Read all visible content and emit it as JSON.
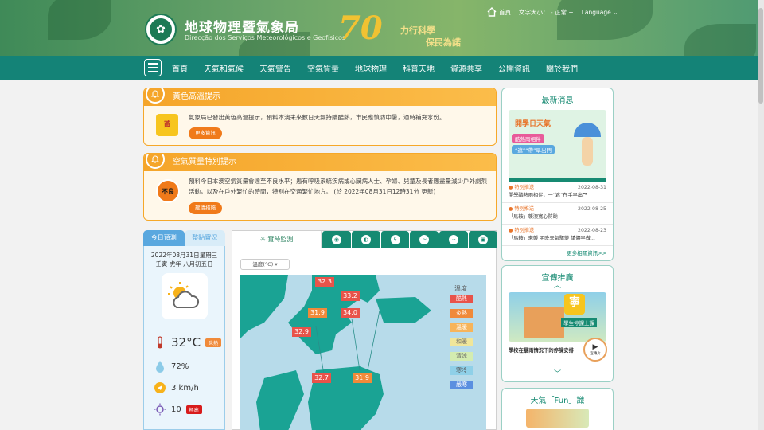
{
  "header": {
    "title": "地球物理暨氣象局",
    "subtitle": "Direcção dos Serviços Meteorológicos e Geofísicos",
    "anniversary": "70",
    "slogan_line1": "力行科學",
    "slogan_line2": "保民為諾",
    "home": "首頁",
    "font_size": "文字大小：",
    "font_minus": "-",
    "font_normal": "正常",
    "font_plus": "+",
    "language": "Language"
  },
  "nav": {
    "items": [
      "首頁",
      "天氣和氣候",
      "天氣警告",
      "空氣質量",
      "地球物理",
      "科普天地",
      "資源共享",
      "公開資訊",
      "關於我們"
    ]
  },
  "alerts": [
    {
      "title": "黃色高溫提示",
      "icon_text": "黃",
      "text": "氣象局已發出黃色高溫提示，預料本澳未來數日天氣持續酷熱，市民應慎防中暑，適時補充水份。",
      "button": "更多資訊"
    },
    {
      "title": "空氣質量特別提示",
      "icon_text": "不良",
      "text": "預料今日本澳空氣質量會達至不良水平；患有呼吸系統疾病或心臟病人士、孕婦、兒童及長者應盡量減少戶外劇烈活動，以及在戶外繁忙的時間，特別在交通繁忙地方。 (於 2022年08月31日12時31分 更新)",
      "button": "建議措施"
    }
  ],
  "forecast": {
    "tab_today": "今日預測",
    "tab_hourly": "整點實況",
    "date_line1": "2022年08月31日星期三",
    "date_line2": "壬寅 虎年 八月初五日",
    "temperature": "32°C",
    "temp_tag": "炎熱",
    "humidity": "72%",
    "wind": "3 km/h",
    "uv": "10",
    "uv_tag": "極高"
  },
  "monitor": {
    "tab_label": "實時監測",
    "select_label": "溫度(°C)",
    "legend_title": "溫度",
    "legend": [
      {
        "label": "酷熱",
        "color": "#e8534a"
      },
      {
        "label": "炎熱",
        "color": "#f08a3a"
      },
      {
        "label": "溫暖",
        "color": "#f7b45a"
      },
      {
        "label": "和暖",
        "color": "#f0e69a"
      },
      {
        "label": "清涼",
        "color": "#d3ecb0"
      },
      {
        "label": "寒冷",
        "color": "#8fd0e8"
      },
      {
        "label": "嚴寒",
        "color": "#5a8fe0"
      }
    ],
    "readings": [
      "32.3",
      "33.2",
      "31.9",
      "34.0",
      "32.9",
      "32.7",
      "31.9"
    ]
  },
  "news": {
    "title": "最新消息",
    "img_line1": "開學日天氣",
    "img_line2": "酷熱雨相伴",
    "img_line3": "“遮”“帶”早出門",
    "items": [
      {
        "cat": "特別推送",
        "date": "2022-08-31",
        "text": "開學酷熱雨相伴，一“遮”在手早出門"
      },
      {
        "cat": "特別推送",
        "date": "2022-08-25",
        "text": "「馬鞍」襲澳寬心防颱"
      },
      {
        "cat": "特別推送",
        "date": "2022-08-23",
        "text": "「馬鞍」來襲 明晚天氣驟變 請儘早做..."
      }
    ],
    "more": "更多相關資訊>>"
  },
  "promo": {
    "title": "宣傳推廣",
    "caption": "學校在暴雨情況下的停課安排",
    "badge": "學生停課上課",
    "video_label": "宣傳片",
    "sign": "寧"
  },
  "fun": {
    "title": "天氣「Fun」識"
  }
}
